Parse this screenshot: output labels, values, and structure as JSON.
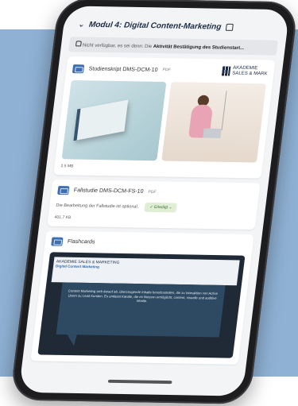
{
  "header": {
    "title": "Modul 4: Digital Content-Marketing"
  },
  "notice": {
    "text_prefix": "Nicht verfügbar, es sei denn: Die ",
    "text_bold": "Aktivität Bestätigung des Studienstart..."
  },
  "card1": {
    "title": "Studienskript DMS-DCM-10",
    "badge": "PDF",
    "logo_line1": "AKADEMIE",
    "logo_line2": "SALES & MARK",
    "size": "2.5 MB"
  },
  "card2": {
    "title": "Fallstudie DMS-DCM-FS-10",
    "badge": "PDF",
    "text": "Die Bearbeitung der Fallstudie ist optional.",
    "button": "Erledigt",
    "size": "401.7 KB"
  },
  "card3": {
    "title": "Flashcards",
    "flash_header": "AKADEMIE SALES & MARKETING",
    "flash_sub": "Digital Content Marketing",
    "bubble_text": "Content Marketing zielt darauf ab, überzeugende Inhalte bereitzustellen, die zu Interaktion von Active Usern zu Lead Kunden. Es umfasst Kanäle, die es Nutzern ermöglicht, content, visuelle und auditive Inhalte."
  },
  "colors": {
    "background": "#8fb1d4",
    "accent": "#3e6fb0",
    "phone": "#1d1d20"
  }
}
